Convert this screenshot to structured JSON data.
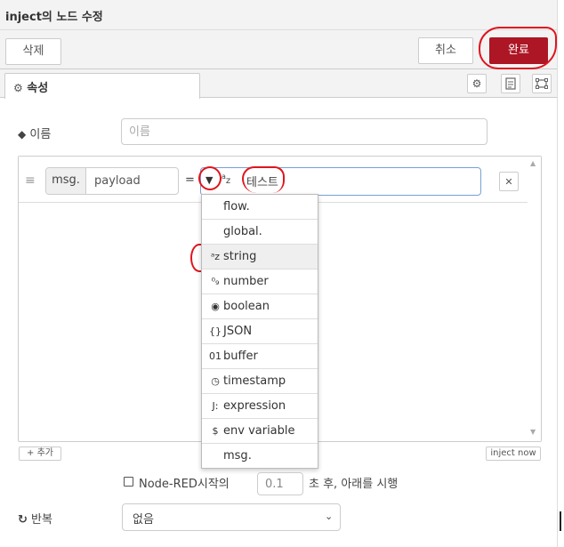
{
  "dialog": {
    "title": "inject의 노드 수정"
  },
  "toolbar": {
    "delete_label": "삭제",
    "cancel_label": "취소",
    "done_label": "완료"
  },
  "tabs": {
    "properties_label": "속성"
  },
  "name_field": {
    "label": "이름",
    "placeholder": "이름",
    "value": ""
  },
  "props": {
    "rows": [
      {
        "prefix": "msg.",
        "property": "payload",
        "equals": "=",
        "type_icon": "az",
        "value": "테스트"
      }
    ],
    "add_label": "추가",
    "inject_now_label": "inject now"
  },
  "type_menu": {
    "items": [
      {
        "icon": "",
        "label": "flow."
      },
      {
        "icon": "",
        "label": "global."
      },
      {
        "icon": "ᵃz",
        "label": "string",
        "selected": true
      },
      {
        "icon": "⁰₉",
        "label": "number"
      },
      {
        "icon": "◉",
        "label": "boolean"
      },
      {
        "icon": "{}",
        "label": "JSON"
      },
      {
        "icon": "01",
        "label": "buffer"
      },
      {
        "icon": "◷",
        "label": "timestamp"
      },
      {
        "icon": "J:",
        "label": "expression"
      },
      {
        "icon": "$",
        "label": "env variable"
      },
      {
        "icon": "",
        "label": "msg."
      }
    ]
  },
  "startup": {
    "label": "Node-RED시작의",
    "delay_value": "0.1",
    "suffix": "초 후, 아래를 시행"
  },
  "repeat": {
    "label": "반복",
    "value": "없음"
  },
  "icons": {
    "gear": "gear-icon",
    "tag": "tag-icon",
    "refresh": "repeat-icon",
    "doc": "description-icon",
    "frame": "appearance-icon",
    "close": "close-icon",
    "plus": "plus-icon"
  },
  "colors": {
    "primary": "#AD1625",
    "annotation": "#e0141e"
  }
}
